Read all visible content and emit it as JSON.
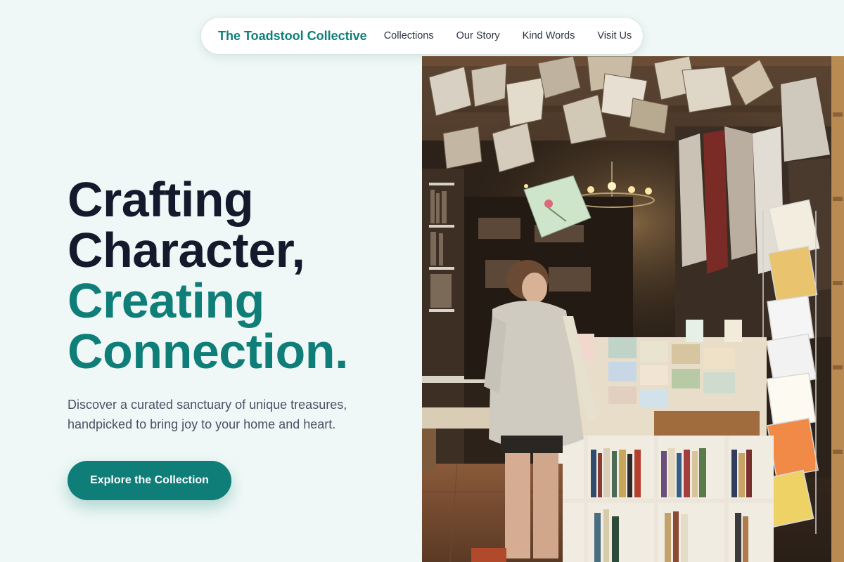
{
  "nav": {
    "brand": "The Toadstool Collective",
    "links": [
      "Collections",
      "Our Story",
      "Kind Words",
      "Visit Us"
    ]
  },
  "hero": {
    "line1": "Crafting",
    "line2": "Character,",
    "line3": "Creating",
    "line4": "Connection.",
    "subtitle": "Discover a curated sanctuary of unique treasures, handpicked to bring joy to your home and heart.",
    "cta_label": "Explore the Collection"
  },
  "colors": {
    "accent": "#0f7e78",
    "background": "#eff8f6",
    "heading": "#131a2c"
  },
  "image": {
    "subject": "woman-browsing-bookshop-with-hanging-books"
  }
}
